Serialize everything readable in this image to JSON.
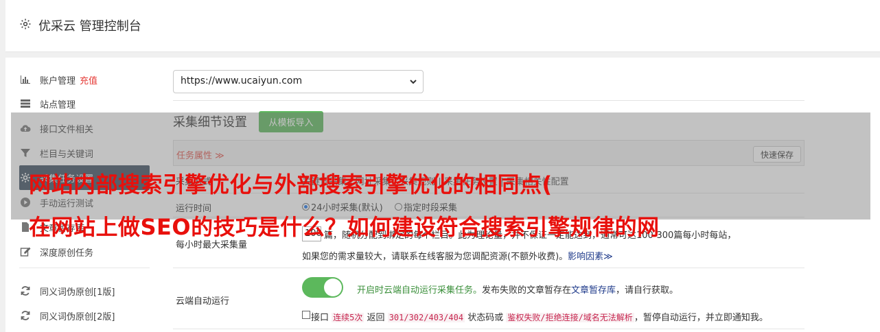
{
  "header": {
    "title": "优采云 管理控制台",
    "icon": "gear-icon"
  },
  "sidebar": {
    "items": [
      {
        "label": "账户管理",
        "badge": "充值",
        "icon": "bar-chart-icon"
      },
      {
        "label": "站点管理",
        "icon": "server-icon"
      },
      {
        "label": "接口文件相关",
        "icon": "cloud-upload-icon"
      },
      {
        "label": "栏目与关键词",
        "icon": "filter-icon"
      },
      {
        "label": "采集任务设置",
        "icon": "gear-icon"
      },
      {
        "label": "手动运行测试",
        "icon": "play-circle-icon"
      },
      {
        "label": "文章暂存库",
        "icon": "file-icon"
      },
      {
        "label": "深度原创任务",
        "icon": "edit-icon"
      },
      {
        "label": "同义词伪原创[1版]",
        "icon": "refresh-icon"
      },
      {
        "label": "同义词伪原创[2版]",
        "icon": "refresh-icon"
      }
    ]
  },
  "site_select": {
    "value": "https://www.ucaiyun.com"
  },
  "section": {
    "title": "采集细节设置",
    "template_button": "从模板导入"
  },
  "panel": {
    "label": "任务属性 ≫",
    "quick_save": "快速保存"
  },
  "rows": {
    "mode_label": "采集方式",
    "mode_text": "关键词采集 | 网址采集 | 采集规则 | 采集任务设置 | 采集相关性配置",
    "runtime_label": "运行时间",
    "runtime_opt1": "24小时采集(默认)",
    "runtime_opt2": "指定时段采集",
    "max_label": "每小时最大采集量",
    "max_value": "100",
    "max_text": "篇，随机分配到绑定的每个栏目。此为理论量，并不保证一定能达到，通常可达100-300篇每小时每站，",
    "max_text2": "如果您的需求量较大，请联系在线客服为您调配资源(不额外收费)。",
    "max_link": "影响因素≫",
    "cloud_label": "云端自动运行",
    "cloud_text1": "开启时云端自动运行采集任务。",
    "cloud_text2": "发布失败的文章暂存在",
    "cloud_link": "文章暂存库",
    "cloud_text3": "，请自行获取。",
    "api_prefix": "接口",
    "api_code1": "连续5次",
    "api_mid1": "返回",
    "api_code2": "301/302/403/404",
    "api_mid2": "状态码或",
    "api_code3": "鉴权失败/拒绝连接/域名无法解析",
    "api_suffix": "，暂停自动运行，并立即通知我。"
  },
  "overlay": {
    "line1": "网站内部搜索引擎优化与外部搜索引擎优化的相同点(",
    "line2": "在网站上做SEO的技巧是什么？如何建设符合搜索引擎规律的网"
  },
  "colors": {
    "accent_green": "#5cb85c",
    "overlay_text": "#e8100c",
    "active_nav": "#3b4d5f"
  }
}
